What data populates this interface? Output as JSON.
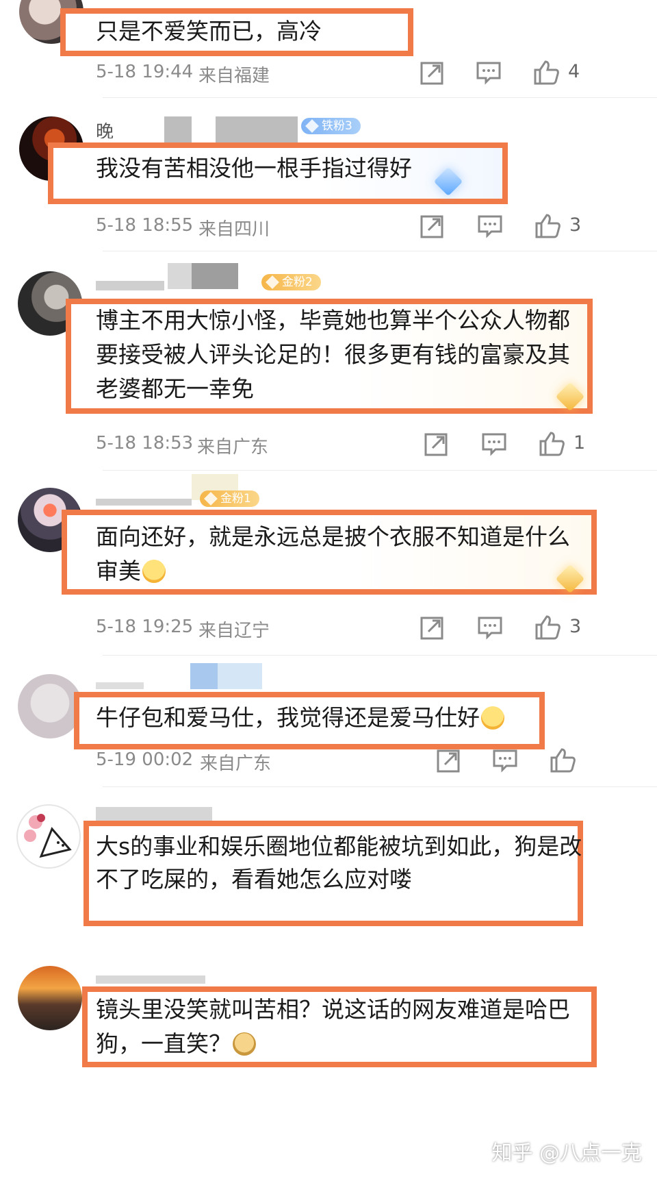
{
  "colors": {
    "highlight_border": "#f07a48",
    "meta_text": "#8a8a8a",
    "icon": "#8a8a8a"
  },
  "icons": [
    "forward-icon",
    "comment-icon",
    "like-icon"
  ],
  "comments": [
    {
      "username": "",
      "badge": "",
      "text_lines": [
        "只是不爱笑而已，高冷"
      ],
      "time": "5-18 19:44",
      "location": "来自福建",
      "likes": "4"
    },
    {
      "username": "晚",
      "badge": "铁粉3",
      "text_lines": [
        "我没有苦相没他一根手指过得好"
      ],
      "time": "5-18 18:55",
      "location": "来自四川",
      "likes": "3"
    },
    {
      "username": "",
      "badge": "金粉2",
      "text_lines": [
        "博主不用大惊小怪，毕竟她也算半个公众人物都",
        "要接受被人评头论足的！很多更有钱的富豪及其",
        "老婆都无一幸免"
      ],
      "time": "5-18 18:53",
      "location": "来自广东",
      "likes": "1"
    },
    {
      "username": "",
      "badge": "金粉1",
      "text_lines": [
        "面向还好，就是永远总是披个衣服不知道是什么",
        "审美"
      ],
      "time": "5-18 19:25",
      "location": "来自辽宁",
      "likes": "3"
    },
    {
      "username": "",
      "badge": "",
      "text_lines": [
        "牛仔包和爱马仕，我觉得还是爱马仕好"
      ],
      "time": "5-19 00:02",
      "location": "来自广东",
      "likes": ""
    },
    {
      "username": "",
      "badge": "",
      "text_lines": [
        "大s的事业和娱乐圈地位都能被坑到如此，狗是改",
        "不了吃屎的，看看她怎么应对喽"
      ],
      "time": "",
      "location": "",
      "likes": ""
    },
    {
      "username": "",
      "badge": "",
      "text_lines": [
        "镜头里没笑就叫苦相？说这话的网友难道是哈巴",
        "狗，一直笑？"
      ],
      "time": "",
      "location": "",
      "likes": ""
    }
  ],
  "watermark": "知乎 @八点一克"
}
